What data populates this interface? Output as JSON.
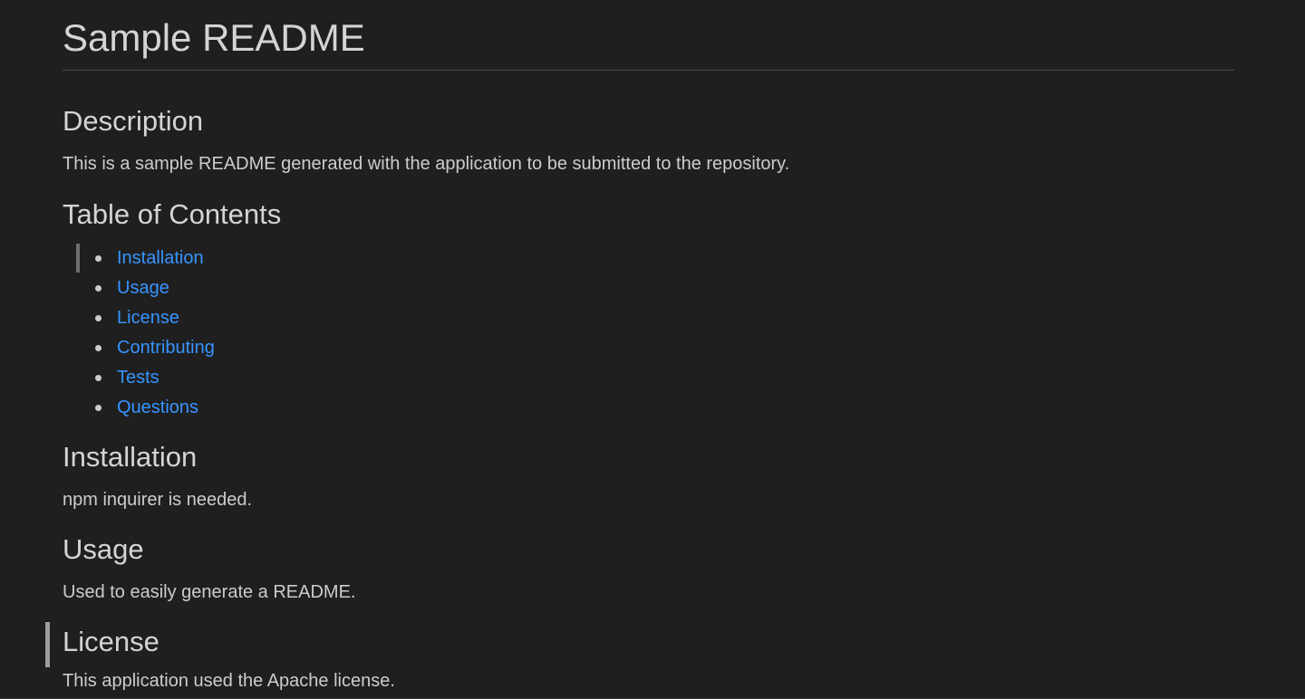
{
  "readme": {
    "title": "Sample README",
    "description": {
      "heading": "Description",
      "text": "This is a sample README generated with the application to be submitted to the repository."
    },
    "toc": {
      "heading": "Table of Contents",
      "items": [
        "Installation",
        "Usage",
        "License",
        "Contributing",
        "Tests",
        "Questions"
      ]
    },
    "installation": {
      "heading": "Installation",
      "text": "npm inquirer is needed."
    },
    "usage": {
      "heading": "Usage",
      "text": "Used to easily generate a README."
    },
    "license": {
      "heading": "License",
      "text": "This application used the Apache license."
    }
  },
  "colors": {
    "background": "#1f1f1f",
    "link": "#3794ff",
    "text": "#cccccc"
  }
}
